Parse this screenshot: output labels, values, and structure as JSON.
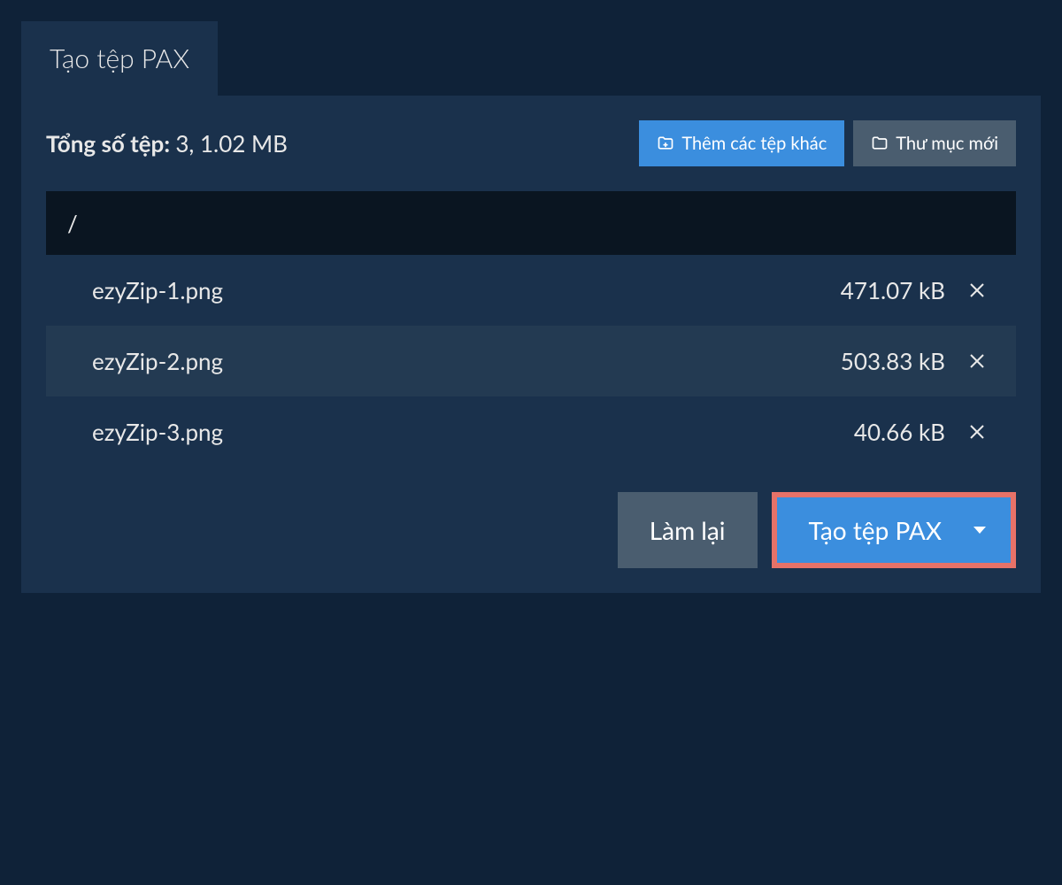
{
  "tab": {
    "label": "Tạo tệp PAX"
  },
  "summary": {
    "label": "Tổng số tệp: ",
    "value": "3, 1.02 MB"
  },
  "buttons": {
    "add_more": "Thêm các tệp khác",
    "new_folder": "Thư mục mới",
    "reset": "Làm lại",
    "create": "Tạo tệp PAX"
  },
  "path": "/",
  "files": [
    {
      "name": "ezyZip-1.png",
      "size": "471.07 kB"
    },
    {
      "name": "ezyZip-2.png",
      "size": "503.83 kB"
    },
    {
      "name": "ezyZip-3.png",
      "size": "40.66 kB"
    }
  ]
}
